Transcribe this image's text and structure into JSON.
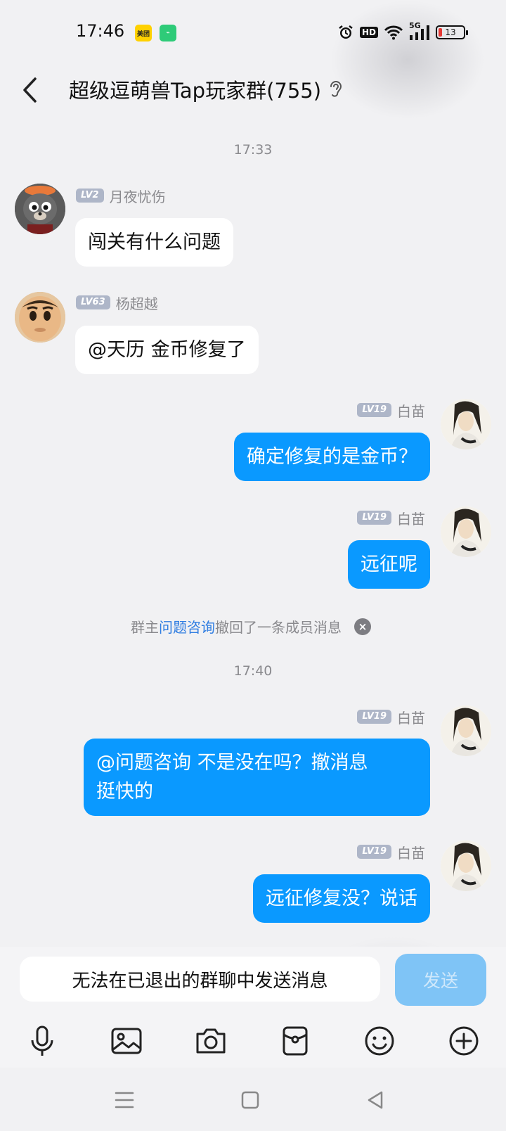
{
  "status_bar": {
    "time": "17:46",
    "app_badges": [
      "美团",
      "⌁"
    ],
    "hd": "HD",
    "network": "5G",
    "battery": "13"
  },
  "header": {
    "title": "超级逗萌兽Tap玩家群(755)"
  },
  "chat": {
    "timestamps": [
      "17:33",
      "17:40"
    ],
    "messages": [
      {
        "sender": "月夜忧伤",
        "level": "LV2",
        "text": "闯关有什么问题"
      },
      {
        "sender": "杨超越",
        "level": "LV63",
        "text": "@天历 金币修复了"
      },
      {
        "sender": "白苗",
        "level": "LV19",
        "text": "确定修复的是金币？"
      },
      {
        "sender": "白苗",
        "level": "LV19",
        "text": "远征呢"
      },
      {
        "sender": "白苗",
        "level": "LV19",
        "line1": "@问题咨询 不是没在吗？撤消息",
        "line2": "挺快的"
      },
      {
        "sender": "白苗",
        "level": "LV19",
        "text": "远征修复没？说话"
      }
    ],
    "recall": {
      "prefix": "群主",
      "link": "问题咨询",
      "suffix": "撤回了一条成员消息"
    }
  },
  "input": {
    "placeholder": "无法在已退出的群聊中发送消息",
    "send_label": "发送"
  },
  "colors": {
    "outgoing_bubble": "#0a99ff",
    "incoming_bubble": "#ffffff",
    "send_button_disabled": "#7fc4f6",
    "link": "#2f7de1"
  }
}
